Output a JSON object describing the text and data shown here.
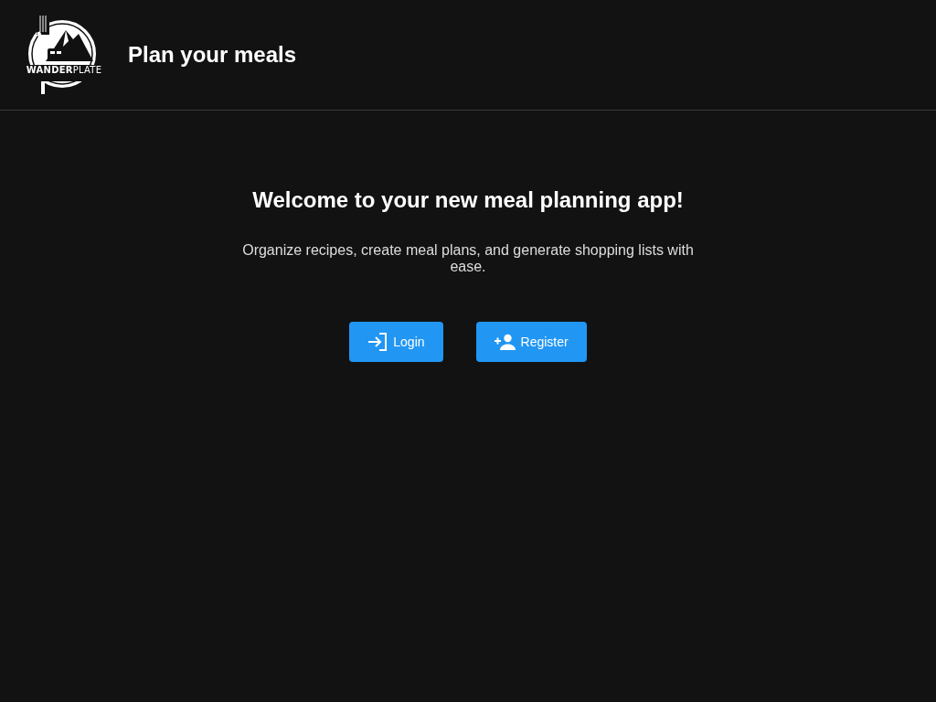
{
  "header": {
    "logo_text": "**WANDER**PLATE",
    "title": "Plan your meals"
  },
  "hero": {
    "heading": "Welcome to your new meal planning app!",
    "text": "Organize recipes, create meal plans, and generate shopping lists with ease."
  },
  "buttons": [
    {
      "kind": "login",
      "label": "Login"
    },
    {
      "kind": "register",
      "label": "Register"
    }
  ]
}
